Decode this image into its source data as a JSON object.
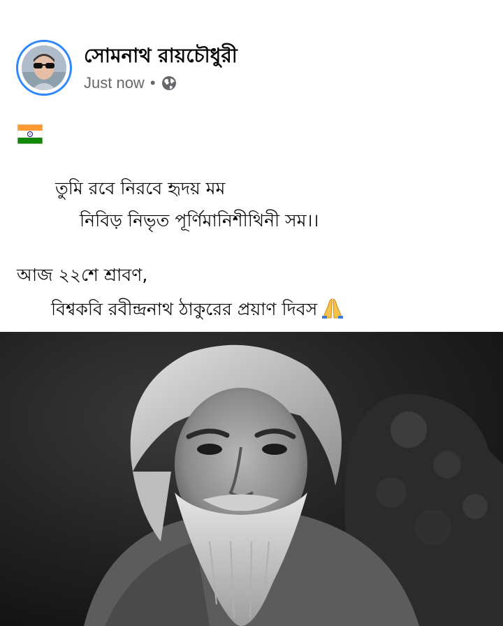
{
  "post": {
    "author_name": "সোমনাথ রায়চৌধুরী",
    "timestamp": "Just now",
    "separator": "•",
    "privacy_icon": "globe-icon",
    "flag_emoji": "india-flag-icon",
    "lines": [
      "তুমি রবে নিরবে হৃদয় মম",
      "নিবিড় নিভৃত পূর্ণিমানিশীথিনী সম।।",
      "আজ ২২শে শ্রাবণ,",
      "বিশ্বকবি রবীন্দ্রনাথ ঠাকুরের প্রয়াণ দিবস"
    ],
    "end_emoji": "folded-hands-icon",
    "photo": "portrait-photo"
  },
  "colors": {
    "avatar_ring": "#2d88ff",
    "meta_text": "#65676b",
    "text": "#050505"
  }
}
